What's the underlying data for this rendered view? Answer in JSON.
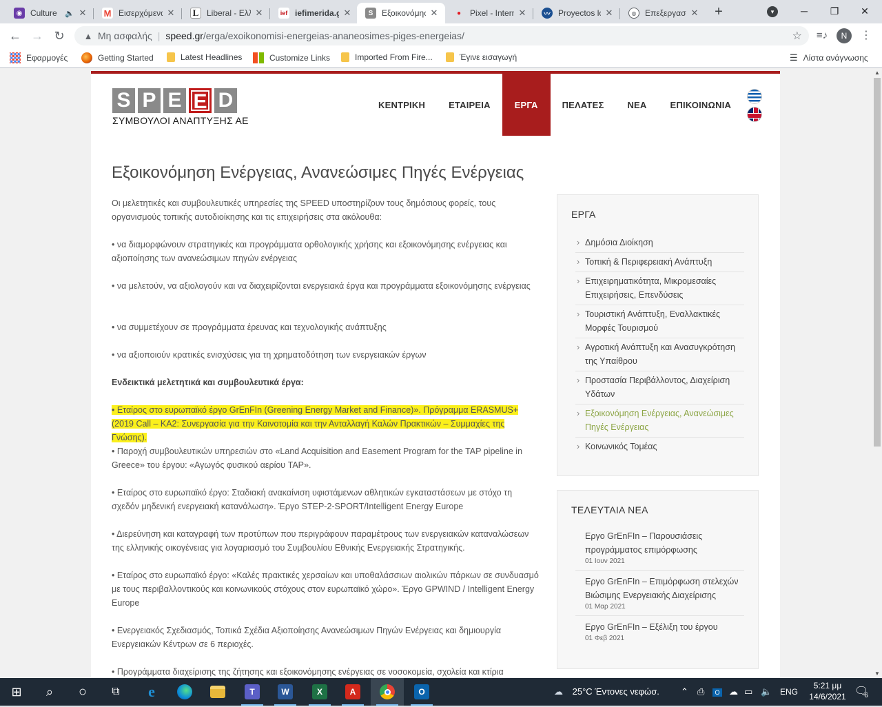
{
  "browser": {
    "tabs": [
      {
        "title": "Culture",
        "icon": "culture-favicon",
        "color": "#6a3ca8",
        "glyph": "◉",
        "muted": true
      },
      {
        "title": "Εισερχόμενα",
        "icon": "gmail-favicon",
        "color": "#ea4335",
        "glyph": "M"
      },
      {
        "title": "Liberal - Ελλ",
        "icon": "liberal-favicon",
        "color": "#222222",
        "glyph": "L"
      },
      {
        "title": "iefimerida.gr",
        "icon": "iefimerida-favicon",
        "color": "#c4161c",
        "glyph": "ief"
      },
      {
        "title": "Εξοικονόμηση",
        "icon": "speed-favicon",
        "color": "#8a8a8a",
        "glyph": "S",
        "active": true
      },
      {
        "title": "Pixel - Intern",
        "icon": "pixel-favicon",
        "color": "#e31b23",
        "glyph": "●"
      },
      {
        "title": "Proyectos lo",
        "icon": "proyectos-favicon",
        "color": "#1b4f91",
        "glyph": "〰"
      },
      {
        "title": "Επεξεργασία",
        "icon": "globe-favicon",
        "color": "#5f6368",
        "glyph": "🌐"
      }
    ],
    "url_security": "Μη ασφαλής",
    "url_host": "speed.gr",
    "url_path": "/erga/exoikonomisi-energeias-ananeosimes-piges-energeias/",
    "profile_initial": "N",
    "bookmarks": [
      {
        "label": "Εφαρμογές",
        "icon": "apps-icon"
      },
      {
        "label": "Getting Started",
        "icon": "firefox-icon"
      },
      {
        "label": "Latest Headlines",
        "icon": "folder-icon"
      },
      {
        "label": "Customize Links",
        "icon": "windows-icon"
      },
      {
        "label": "Imported From Fire...",
        "icon": "folder-icon"
      },
      {
        "label": "Έγινε εισαγωγή",
        "icon": "folder-icon"
      }
    ],
    "reading_list": "Λίστα ανάγνωσης"
  },
  "site": {
    "logo_letters": [
      "S",
      "P",
      "E",
      "E",
      "D"
    ],
    "logo_subtitle": "ΣΥΜΒΟΥΛΟΙ ΑΝΑΠΤΥΞΗΣ ΑΕ",
    "brand_color": "#a81d1d",
    "nav": [
      "ΚΕΝΤΡΙΚΗ",
      "ΕΤΑΙΡΕΙΑ",
      "ΕΡΓΑ",
      "ΠΕΛΑΤΕΣ",
      "ΝΕΑ",
      "ΕΠΙΚΟΙΝΩΝΙΑ"
    ],
    "nav_active": "ΕΡΓΑ"
  },
  "page": {
    "title": "Εξοικονόμηση Ενέργειας, Ανανεώσιμες Πηγές Ενέργειας",
    "paragraphs": [
      "Οι μελετητικές και συμβουλευτικές υπηρεσίες της SPEED υποστηρίζουν τους δημόσιους φορείς, τους οργανισμούς τοπικής αυτοδιοίκησης και τις επιχειρήσεις στα ακόλουθα:",
      "• να διαμορφώνουν στρατηγικές και προγράμματα ορθολογικής χρήσης και εξοικονόμησης ενέργειας και αξιοποίησης των ανανεώσιμων πηγών ενέργειας",
      "• να μελετούν, να αξιολογούν και να διαχειρίζονται ενεργειακά έργα και προγράμματα εξοικονόμησης ενέργειας",
      "• να συμμετέχουν σε προγράμματα έρευνας και τεχνολογικής ανάπτυξης",
      "• να αξιοποιούν κρατικές ενισχύσεις για τη χρηματοδότηση των ενεργειακών έργων",
      "Ενδεικτικά μελετητικά και συμβουλευτικά έργα:",
      "•  Εταίρος στο ευρωπαϊκό έργο GrEnFIn (Greening Energy Market and Finance)». Πρόγραμμα ERASMUS+ (2019 Call – KA2: Συνεργασία για την Καινοτομία και την Ανταλλαγή Καλών Πρακτικών – Συμμαχίες της Γνώσης).",
      "•  Παροχή συμβουλευτικών υπηρεσιών στο «Land Acquisition and Easement Program for the TAP pipeline in Greece» του έργου: «Αγωγός φυσικού αερίου TAP».",
      "•  Εταίρος στο ευρωπαϊκό έργο: Σταδιακή ανακαίνιση υφιστάμενων αθλητικών εγκαταστάσεων με στόχο τη σχεδόν μηδενική ενεργειακή κατανάλωση». Έργο STEP-2-SPORT/Intelligent Energy Europe",
      "• Διερεύνηση και καταγραφή των προτύπων που περιγράφουν παραμέτρους των ενεργειακών καταναλώσεων της ελληνικής οικογένειας για λογαριασμό του Συμβουλίου Εθνικής Ενεργειακής Στρατηγικής.",
      "•  Εταίρος στο ευρωπαϊκό έργο: «Καλές πρακτικές χερσαίων και υποθαλάσσιων αιολικών πάρκων σε συνδυασμό με τους περιβαλλοντικούς και κοινωνικούς στόχους στον ευρωπαϊκό χώρο».  Έργο GPWIND / Intelligent Energy Europe",
      "•  Ενεργειακός Σχεδιασμός, Τοπικά Σχέδια Αξιοποίησης Ανανεώσιμων Πηγών Ενέργειας και δημιουργία Ενεργειακών Κέντρων σε 6 περιοχές.",
      "• Προγράμματα διαχείρισης της ζήτησης και εξοικονόμησης ενέργειας σε νοσοκομεία, σχολεία και κτίρια"
    ],
    "highlight_color": "#fbf01c"
  },
  "sidebar": {
    "erga_title": "ΕΡΓΑ",
    "erga_items": [
      "Δημόσια Διοίκηση",
      "Τοπική & Περιφερειακή Ανάπτυξη",
      "Επιχειρηματικότητα, Μικρομεσαίες Επιχειρήσεις, Επενδύσεις",
      "Τουριστική Ανάπτυξη, Εναλλακτικές Μορφές Τουρισμού",
      "Αγροτική Ανάπτυξη και Ανασυγκρότηση της Υπαίθρου",
      "Προστασία Περιβάλλοντος, Διαχείριση Υδάτων",
      "Εξοικονόμηση Ενέργειας, Ανανεώσιμες Πηγές Ενέργειας",
      "Κοινωνικός Τομέας"
    ],
    "erga_current": "Εξοικονόμηση Ενέργειας, Ανανεώσιμες Πηγές Ενέργειας",
    "current_color": "#8ca545",
    "news_title": "ΤΕΛΕΥΤΑΙΑ ΝΕΑ",
    "news": [
      {
        "title": "Εργο GrEnFIn – Παρουσιάσεις προγράμματος επιμόρφωσης",
        "date": "01 Ιουν 2021"
      },
      {
        "title": "Εργο GrEnFIn – Επιμόρφωση στελεχών Βιώσιμης Ενεργειακής Διαχείρισης",
        "date": "01 Μαρ 2021"
      },
      {
        "title": "Εργο GrEnFIn – Εξέλιξη του έργου",
        "date": "01 Φεβ 2021"
      }
    ]
  },
  "taskbar": {
    "apps": [
      {
        "name": "start-button",
        "glyph": "⊞",
        "color": "transparent"
      },
      {
        "name": "search-button",
        "glyph": "⌕",
        "color": "transparent"
      },
      {
        "name": "cortana-button",
        "glyph": "○",
        "color": "transparent"
      },
      {
        "name": "task-view-button",
        "glyph": "⧉",
        "color": "transparent"
      },
      {
        "name": "internet-explorer-app",
        "glyph": "e",
        "color": "#1e90d6"
      },
      {
        "name": "edge-app",
        "glyph": "◐",
        "color": "#1aa3c9"
      },
      {
        "name": "file-explorer-app",
        "glyph": "▭",
        "color": "#e8b83a"
      },
      {
        "name": "teams-app",
        "glyph": "T",
        "color": "#5b5fc7"
      },
      {
        "name": "word-app",
        "glyph": "W",
        "color": "#2b5797"
      },
      {
        "name": "excel-app",
        "glyph": "X",
        "color": "#1e7145"
      },
      {
        "name": "acrobat-app",
        "glyph": "A",
        "color": "#d4291c"
      },
      {
        "name": "chrome-app",
        "glyph": "◉",
        "color": "#34a853"
      },
      {
        "name": "outlook-app",
        "glyph": "O",
        "color": "#0a64ad"
      }
    ],
    "weather": "25°C  Έντονες νεφώσ.",
    "language": "ENG",
    "time": "5:21 μμ",
    "date": "14/6/2021",
    "notifications": "6"
  }
}
